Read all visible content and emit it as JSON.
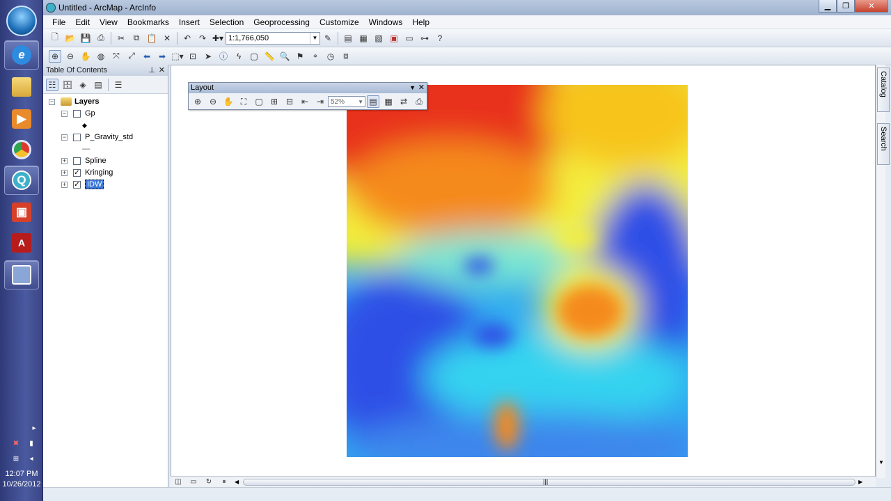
{
  "window": {
    "title": "Untitled - ArcMap - ArcInfo"
  },
  "menus": [
    "File",
    "Edit",
    "View",
    "Bookmarks",
    "Insert",
    "Selection",
    "Geoprocessing",
    "Customize",
    "Windows",
    "Help"
  ],
  "toolbar": {
    "scale": "1:1,766,050"
  },
  "toc": {
    "title": "Table Of Contents",
    "root": "Layers",
    "layers": [
      {
        "name": "Gp",
        "checked": false,
        "expanded": true,
        "legend": "◆"
      },
      {
        "name": "P_Gravity_std",
        "checked": false,
        "expanded": true,
        "legend": "—"
      },
      {
        "name": "Spline",
        "checked": false,
        "expanded": false
      },
      {
        "name": "Kringing",
        "checked": true,
        "expanded": false
      },
      {
        "name": "IDW",
        "checked": true,
        "expanded": false,
        "selected": true
      }
    ]
  },
  "layout_toolbar": {
    "title": "Layout",
    "zoom": "52%"
  },
  "side_tabs": [
    "Catalog",
    "Search"
  ],
  "taskbar": {
    "time": "12:07 PM",
    "date": "10/26/2012"
  },
  "colors": {
    "red": "#e8321e",
    "orange": "#f58a1e",
    "yellow": "#f3ef3c",
    "cyan": "#35d3f0",
    "blue": "#2f50e6"
  }
}
